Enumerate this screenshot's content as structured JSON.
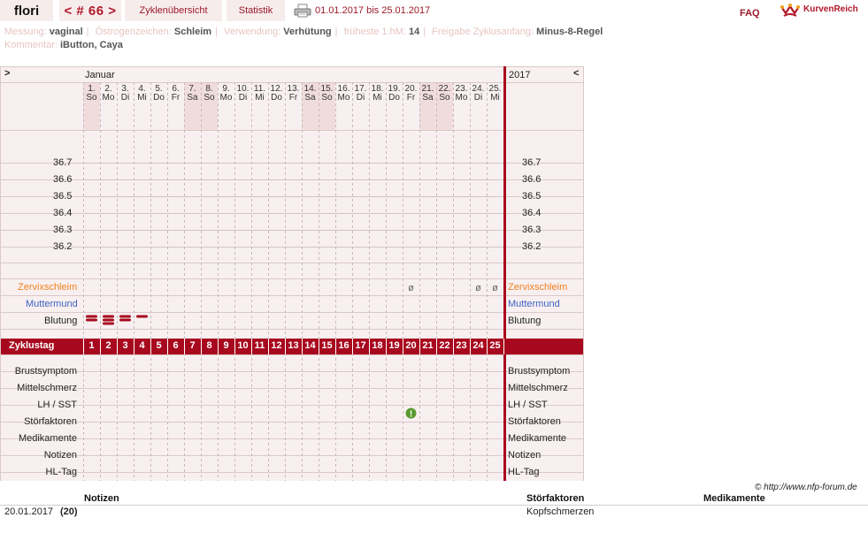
{
  "header": {
    "user": "flori",
    "cycle_nav": "< # 66 >",
    "tab_overview": "Zyklenübersicht",
    "tab_statistics": "Statistik",
    "date_range": "01.01.2017 bis 25.01.2017",
    "faq": "FAQ",
    "logo_text": "KurvenReich",
    "print_icon": "printer-icon",
    "logo_icon": "crown-curve-icon"
  },
  "settings": {
    "measurement_label": "Messung:",
    "measurement_value": "vaginal",
    "estrogen_label": "Östrogenzeichen:",
    "estrogen_value": "Schleim",
    "usage_label": "Verwendung:",
    "usage_value": "Verhütung",
    "earliest_label": "früheste 1.hM:",
    "earliest_value": "14",
    "release_label": "Freigabe Zyklusanfang:",
    "release_value": "Minus-8-Regel",
    "comment_label": "Kommentar:",
    "comment_value": "iButton, Caya"
  },
  "chart": {
    "nav_prev": ">",
    "nav_next": "<",
    "month": "Januar",
    "year": "2017",
    "days": [
      {
        "num": "1.",
        "wd": "So",
        "weekend": true
      },
      {
        "num": "2.",
        "wd": "Mo",
        "weekend": false
      },
      {
        "num": "3.",
        "wd": "Di",
        "weekend": false
      },
      {
        "num": "4.",
        "wd": "Mi",
        "weekend": false
      },
      {
        "num": "5.",
        "wd": "Do",
        "weekend": false
      },
      {
        "num": "6.",
        "wd": "Fr",
        "weekend": false
      },
      {
        "num": "7.",
        "wd": "Sa",
        "weekend": true
      },
      {
        "num": "8.",
        "wd": "So",
        "weekend": true
      },
      {
        "num": "9.",
        "wd": "Mo",
        "weekend": false
      },
      {
        "num": "10.",
        "wd": "Di",
        "weekend": false
      },
      {
        "num": "11.",
        "wd": "Mi",
        "weekend": false
      },
      {
        "num": "12.",
        "wd": "Do",
        "weekend": false
      },
      {
        "num": "13.",
        "wd": "Fr",
        "weekend": false
      },
      {
        "num": "14.",
        "wd": "Sa",
        "weekend": true
      },
      {
        "num": "15.",
        "wd": "So",
        "weekend": true
      },
      {
        "num": "16.",
        "wd": "Mo",
        "weekend": false
      },
      {
        "num": "17.",
        "wd": "Di",
        "weekend": false
      },
      {
        "num": "18.",
        "wd": "Mi",
        "weekend": false
      },
      {
        "num": "19.",
        "wd": "Do",
        "weekend": false
      },
      {
        "num": "20.",
        "wd": "Fr",
        "weekend": false
      },
      {
        "num": "21.",
        "wd": "Sa",
        "weekend": true
      },
      {
        "num": "22.",
        "wd": "So",
        "weekend": true
      },
      {
        "num": "23.",
        "wd": "Mo",
        "weekend": false
      },
      {
        "num": "24.",
        "wd": "Di",
        "weekend": false
      },
      {
        "num": "25.",
        "wd": "Mi",
        "weekend": false
      }
    ],
    "temperatures": [
      "36.7",
      "36.6",
      "36.5",
      "36.4",
      "36.3",
      "36.2"
    ],
    "cervix_mucus_label": "Zervixschleim",
    "cervix_label": "Muttermund",
    "bleeding_label": "Blutung",
    "cycle_day_label": "Zyklustag",
    "cycle_days": [
      "1",
      "2",
      "3",
      "4",
      "5",
      "6",
      "7",
      "8",
      "9",
      "10",
      "11",
      "12",
      "13",
      "14",
      "15",
      "16",
      "17",
      "18",
      "19",
      "20",
      "21",
      "22",
      "23",
      "24",
      "25"
    ],
    "mucus_marks": [
      {
        "day": 20,
        "symbol": "ø"
      },
      {
        "day": 24,
        "symbol": "ø"
      },
      {
        "day": 25,
        "symbol": "ø"
      }
    ],
    "bleeding": [
      {
        "day": 1,
        "level": 2
      },
      {
        "day": 2,
        "level": 3
      },
      {
        "day": 3,
        "level": 2
      },
      {
        "day": 4,
        "level": 1
      }
    ],
    "disturbance_marks": [
      {
        "day": 20,
        "icon": "exclamation-icon"
      }
    ],
    "lower_rows": [
      "Brustsymptom",
      "Mittelschmerz",
      "LH / SST",
      "Störfaktoren",
      "Medikamente",
      "Notizen",
      "HL-Tag"
    ],
    "colors": {
      "accent": "#a8081e",
      "bg_panel": "#f8f0f0",
      "weekend": "#f0dcdc",
      "mucus": "#f08020",
      "cervix": "#4060c0",
      "ok_green": "#5a9a30"
    }
  },
  "footer": {
    "copyright": "© http://www.nfp-forum.de",
    "notes_header": "Notizen",
    "disturbance_header": "Störfaktoren",
    "medication_header": "Medikamente",
    "entries": [
      {
        "date": "20.01.2017",
        "day": "(20)",
        "notes": "",
        "disturbance": "Kopfschmerzen",
        "medication": ""
      }
    ]
  }
}
